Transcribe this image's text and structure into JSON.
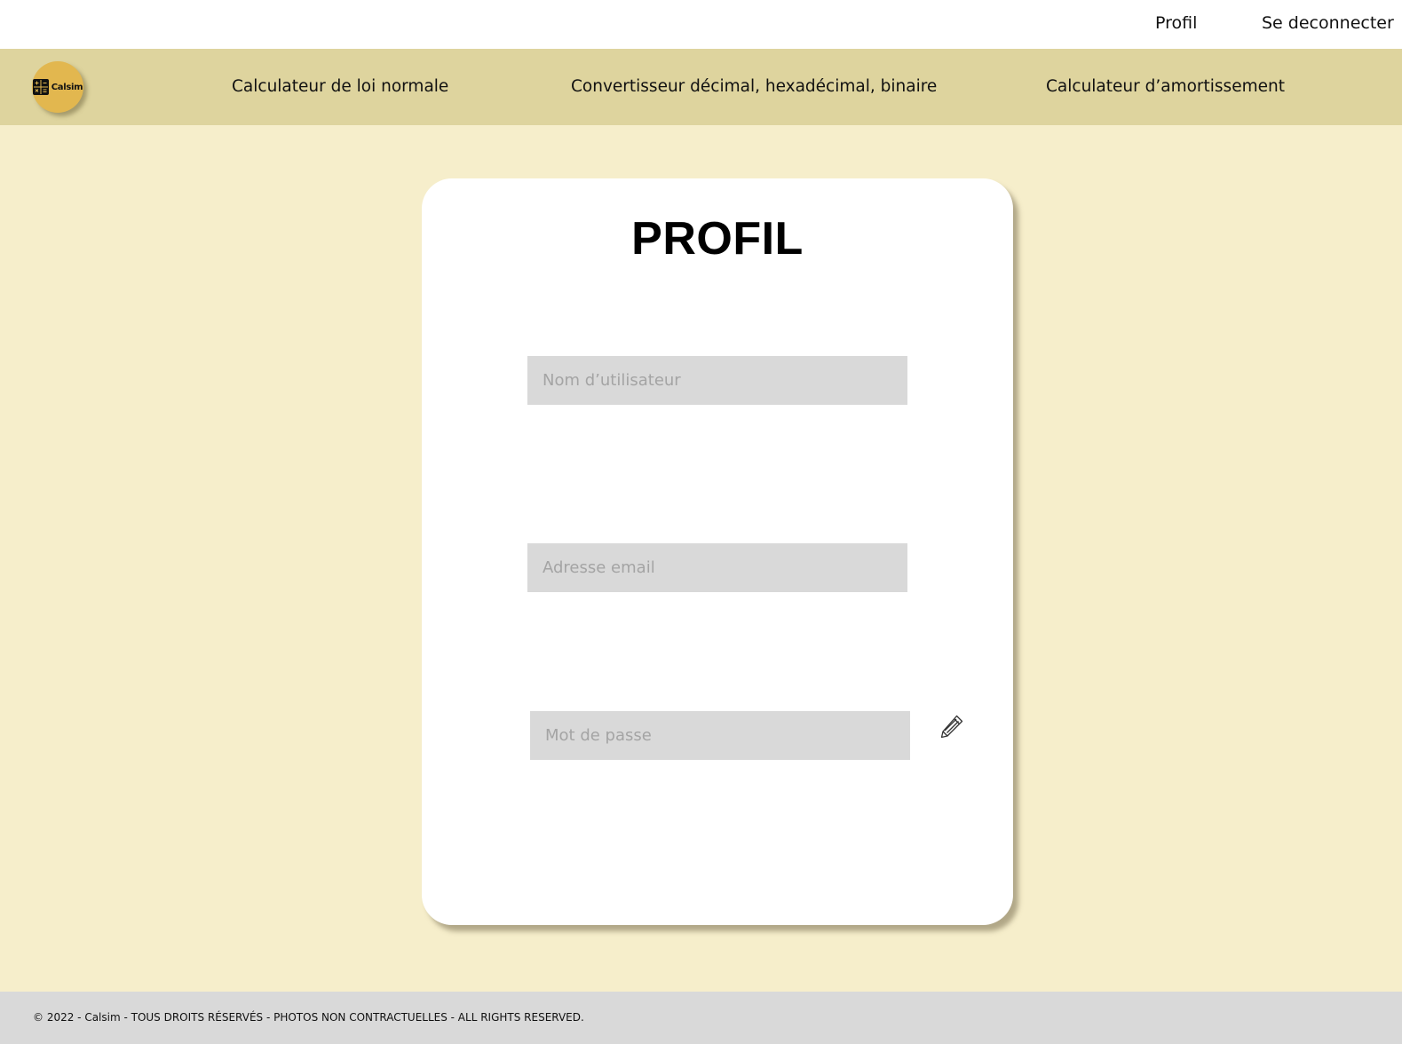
{
  "topbar": {
    "profile_link": "Profil",
    "logout_link": "Se deconnecter"
  },
  "brand": {
    "name": "Calsim",
    "icon": "calculator-icon",
    "color": "#e2b74f"
  },
  "nav": {
    "items": [
      {
        "label": "Calculateur de loi normale"
      },
      {
        "label": "Convertisseur décimal, hexadécimal, binaire"
      },
      {
        "label": "Calculateur d’amortissement"
      }
    ]
  },
  "profile": {
    "title": "PROFIL",
    "username": {
      "placeholder": "Nom d’utilisateur",
      "value": ""
    },
    "email": {
      "placeholder": "Adresse email",
      "value": ""
    },
    "password": {
      "placeholder": "Mot de passe",
      "value": ""
    },
    "edit_icon": "pencil-icon"
  },
  "footer": {
    "text": "© 2022 - Calsim - TOUS DROITS RÉSERVÉS - PHOTOS NON CONTRACTUELLES - ALL RIGHTS RESERVED."
  },
  "colors": {
    "page_background": "#f6eecb",
    "nav_background": "#ded49e",
    "field_background": "#d9d9d9",
    "footer_background": "#d9d9d9"
  }
}
